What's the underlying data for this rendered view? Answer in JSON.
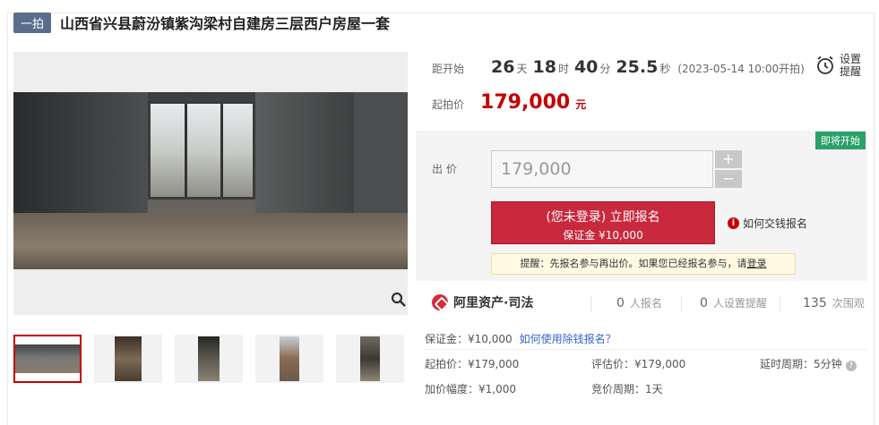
{
  "header": {
    "tag": "一拍",
    "title": "山西省兴县蔚汾镇紫沟梁村自建房三层西户房屋一套"
  },
  "countdown": {
    "label": "距开始",
    "days": "26",
    "days_unit": "天",
    "hours": "18",
    "hours_unit": "时",
    "minutes": "40",
    "minutes_unit": "分",
    "seconds": "25.5",
    "seconds_unit": "秒",
    "start_date": "(2023-05-14 10:00开拍)"
  },
  "reminder": {
    "line1": "设置",
    "line2": "提醒",
    "icon": "alarm-clock-icon"
  },
  "start_price": {
    "label": "起拍价",
    "value": "179,000",
    "unit": "元"
  },
  "bid": {
    "badge": "即将开始",
    "label": "出 价",
    "input_value": "179,000",
    "plus": "+",
    "minus": "−",
    "signup_line1": "(您未登录) 立即报名",
    "signup_line2": "保证金 ¥10,000",
    "how_pay": "如何交钱报名",
    "tip_text": "提醒：先报名参与再出价。如果您已经报名参与，请",
    "tip_login": "登录"
  },
  "stats": {
    "brand": "阿里资产·司法",
    "signups_n": "0",
    "signups_label": "人报名",
    "reminders_n": "0",
    "reminders_label": "人设置提醒",
    "views_n": "135",
    "views_label": "次围观"
  },
  "info": {
    "deposit": "保证金：¥10,000",
    "deposit_link": "如何使用除钱报名？",
    "start_price": "起拍价：¥179,000",
    "assessed": "评估价：¥179,000",
    "delay": "延时周期：5分钟",
    "increment": "加价幅度：¥1,000",
    "cycle": "竞价周期：1天"
  },
  "colors": {
    "accent": "#c40000",
    "button": "#c9293d",
    "badge": "#2aa16a",
    "link": "#3366cc"
  }
}
